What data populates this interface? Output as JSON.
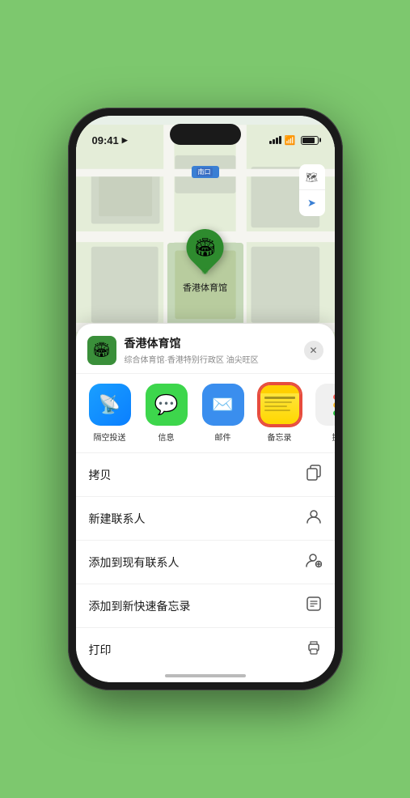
{
  "status_bar": {
    "time": "09:41",
    "location_arrow": "▶"
  },
  "map": {
    "location_label": "南口",
    "pin_label": "香港体育馆",
    "controls": {
      "map_icon": "🗺",
      "location_icon": "◎"
    }
  },
  "venue": {
    "name": "香港体育馆",
    "subtitle": "综合体育馆·香港特别行政区 油尖旺区",
    "icon": "🏟"
  },
  "share_items": [
    {
      "id": "airdrop",
      "label": "隔空投送",
      "type": "airdrop"
    },
    {
      "id": "messages",
      "label": "信息",
      "type": "messages"
    },
    {
      "id": "mail",
      "label": "邮件",
      "type": "mail"
    },
    {
      "id": "notes",
      "label": "备忘录",
      "type": "notes"
    },
    {
      "id": "more",
      "label": "提",
      "type": "more"
    }
  ],
  "actions": [
    {
      "id": "copy",
      "label": "拷贝",
      "icon": "📋"
    },
    {
      "id": "new-contact",
      "label": "新建联系人",
      "icon": "👤"
    },
    {
      "id": "add-existing",
      "label": "添加到现有联系人",
      "icon": "👤"
    },
    {
      "id": "add-notes",
      "label": "添加到新快速备忘录",
      "icon": "📝"
    },
    {
      "id": "print",
      "label": "打印",
      "icon": "🖨"
    }
  ],
  "close_button": "✕"
}
